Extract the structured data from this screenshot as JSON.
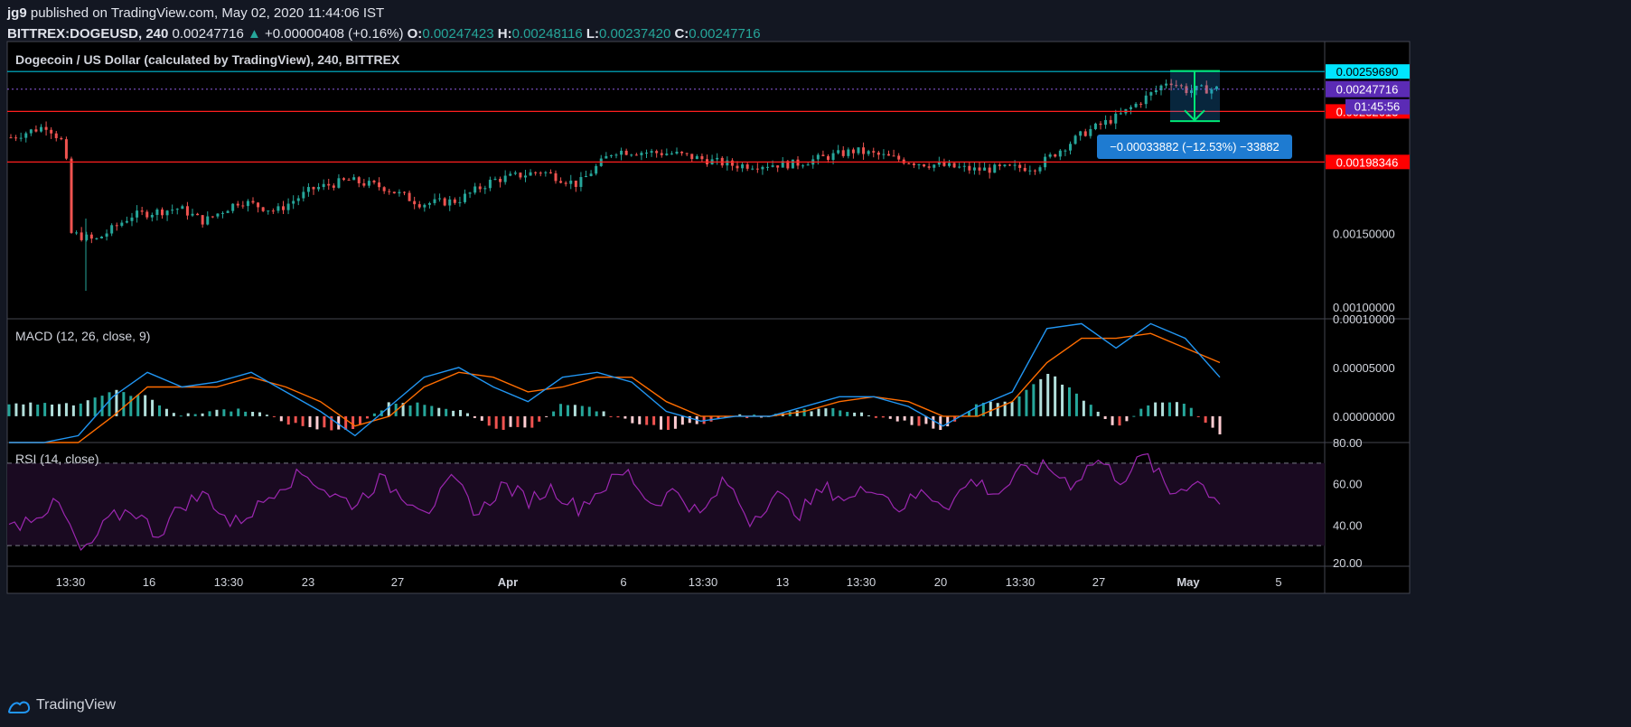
{
  "header": {
    "user": "jg9",
    "published": "published on TradingView.com, May 02, 2020 11:44:06 IST",
    "symbol": "BITTREX:DOGEUSD, 240",
    "last": "0.00247716",
    "change": "+0.00000408 (+0.16%)",
    "open_label": "O:",
    "open": "0.00247423",
    "high_label": "H:",
    "high": "0.00248116",
    "low_label": "L:",
    "low": "0.00237420",
    "close_label": "C:",
    "close": "0.00247716"
  },
  "footer": {
    "brand": "TradingView",
    "logo_icon": "tradingview-logo-icon"
  },
  "colors": {
    "background": "#000000",
    "page": "#131722",
    "up": "#26a69a",
    "down": "#ef5350",
    "cyan_line": "#00bcd4",
    "red_line": "#ff1e1e",
    "macd": "#2196f3",
    "signal": "#ff6d00",
    "rsi": "#9c27b0",
    "rsi_band": "#1a0a21",
    "purple_tag": "#5b2bb5",
    "measure_box": "#1e7bd1"
  },
  "chart_data": [
    {
      "type": "candlestick",
      "title": "Dogecoin / US Dollar (calculated by TradingView), 240, BITTREX",
      "y_axis_ticks": [
        "0.00150000",
        "0.00100000"
      ],
      "ylim": [
        0.00092,
        0.0028
      ],
      "x_ticks": [
        "13:30",
        "16",
        "13:30",
        "23",
        "27",
        "Apr",
        "6",
        "13:30",
        "13",
        "13:30",
        "20",
        "13:30",
        "27",
        "May",
        "5"
      ],
      "horizontal_lines": [
        {
          "value": 0.0025969,
          "label": "0.00259690",
          "color": "#00bcd4"
        },
        {
          "value": 0.00232613,
          "label": "0.00232613",
          "color": "#ff1e1e"
        },
        {
          "value": 0.00198346,
          "label": "0.00198346",
          "color": "#ff1e1e"
        }
      ],
      "price_tag": {
        "value": 0.00247716,
        "label": "0.00247716",
        "countdown": "01:45:56"
      },
      "measure_label": "−0.00033882 (−12.53%) −33882",
      "path": [
        [
          0,
          0.00215
        ],
        [
          0.03,
          0.00223
        ],
        [
          0.045,
          0.0021
        ],
        [
          0.05,
          0.0015
        ],
        [
          0.07,
          0.00145
        ],
        [
          0.1,
          0.00162
        ],
        [
          0.14,
          0.00167
        ],
        [
          0.16,
          0.00158
        ],
        [
          0.19,
          0.00172
        ],
        [
          0.22,
          0.00165
        ],
        [
          0.25,
          0.0018
        ],
        [
          0.28,
          0.00186
        ],
        [
          0.31,
          0.00181
        ],
        [
          0.34,
          0.0017
        ],
        [
          0.37,
          0.00172
        ],
        [
          0.4,
          0.00186
        ],
        [
          0.44,
          0.00192
        ],
        [
          0.47,
          0.00183
        ],
        [
          0.5,
          0.00206
        ],
        [
          0.55,
          0.00204
        ],
        [
          0.6,
          0.00196
        ],
        [
          0.65,
          0.00197
        ],
        [
          0.7,
          0.00206
        ],
        [
          0.75,
          0.00198
        ],
        [
          0.8,
          0.00193
        ],
        [
          0.85,
          0.00195
        ],
        [
          0.89,
          0.00218
        ],
        [
          0.92,
          0.0023
        ],
        [
          0.95,
          0.00247
        ],
        [
          0.96,
          0.00254
        ],
        [
          0.975,
          0.00247
        ],
        [
          1.0,
          0.00248
        ]
      ]
    },
    {
      "type": "line",
      "title": "MACD (12, 26, close, 9)",
      "y_axis_ticks": [
        "0.00010000",
        "0.00005000",
        "0.00000000"
      ],
      "ylim": [
        -2.7e-05,
        0.0001
      ],
      "series": [
        {
          "color": "#2196f3",
          "values": [
            -4e-05,
            -3e-05,
            -2e-05,
            2e-05,
            4.5e-05,
            3e-05,
            3.5e-05,
            4.5e-05,
            2.5e-05,
            5e-06,
            -2e-05,
            1e-05,
            4e-05,
            5e-05,
            3e-05,
            1.5e-05,
            4e-05,
            4.5e-05,
            3.5e-05,
            5e-06,
            -5e-06,
            0.0,
            0.0,
            1e-05,
            2e-05,
            2e-05,
            1e-05,
            -1e-05,
            1e-05,
            2.5e-05,
            9e-05,
            9.5e-05,
            7e-05,
            9.5e-05,
            8e-05,
            4e-05
          ]
        },
        {
          "color": "#ff6d00",
          "values": [
            -5e-05,
            -4e-05,
            -3e-05,
            0.0,
            3e-05,
            3e-05,
            3e-05,
            4e-05,
            3e-05,
            1.5e-05,
            -1e-05,
            0.0,
            3e-05,
            4.5e-05,
            4e-05,
            2.5e-05,
            3e-05,
            4e-05,
            4e-05,
            1.5e-05,
            0.0,
            0.0,
            0.0,
            5e-06,
            1.5e-05,
            2e-05,
            1.5e-05,
            0.0,
            0.0,
            1.5e-05,
            5.5e-05,
            8e-05,
            8e-05,
            8.5e-05,
            7e-05,
            5.5e-05
          ]
        }
      ]
    },
    {
      "type": "line",
      "title": "RSI (14, close)",
      "y_axis_ticks": [
        "80.00",
        "60.00",
        "40.00",
        "20.00"
      ],
      "ylim": [
        20,
        80
      ],
      "bands": [
        70,
        30
      ],
      "series": [
        {
          "color": "#9c27b0",
          "values": [
            38,
            45,
            50,
            25,
            42,
            48,
            35,
            50,
            55,
            40,
            48,
            60,
            65,
            55,
            50,
            62,
            54,
            48,
            62,
            45,
            60,
            52,
            58,
            48,
            58,
            66,
            50,
            57,
            44,
            62,
            42,
            55,
            46,
            58,
            52,
            60,
            48,
            56,
            50,
            62,
            55,
            66,
            68,
            60,
            72,
            62,
            74,
            55,
            62,
            52
          ]
        }
      ]
    }
  ]
}
